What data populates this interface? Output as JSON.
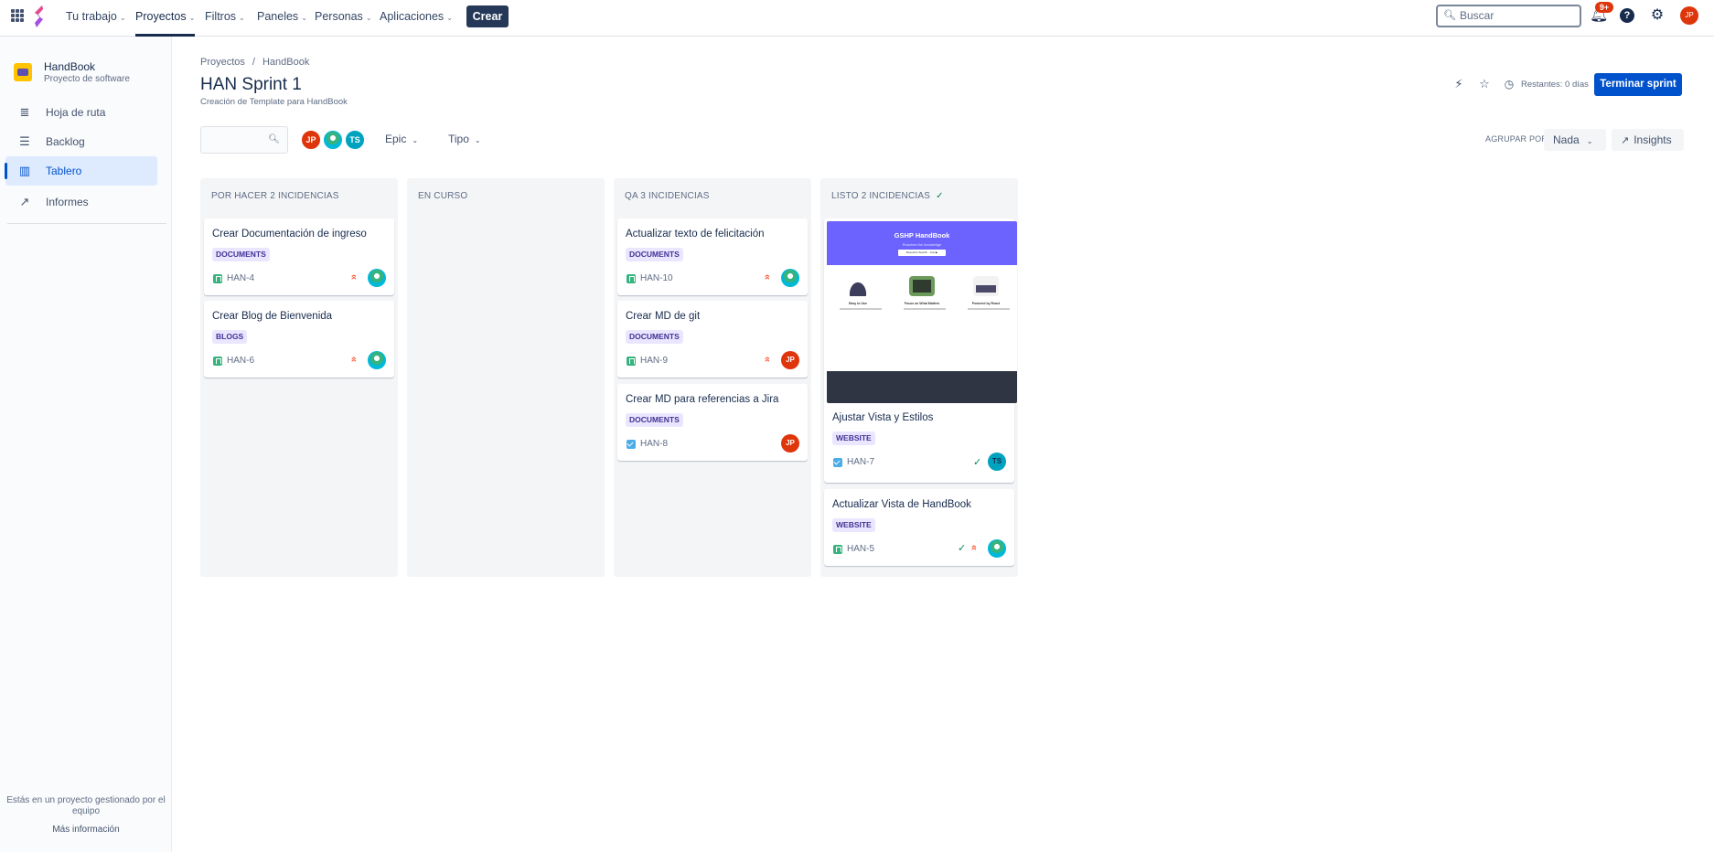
{
  "topnav": {
    "items": [
      {
        "label": "Tu trabajo"
      },
      {
        "label": "Proyectos"
      },
      {
        "label": "Filtros"
      },
      {
        "label": "Paneles"
      },
      {
        "label": "Personas"
      },
      {
        "label": "Aplicaciones"
      }
    ],
    "create_label": "Crear",
    "search_placeholder": "Buscar",
    "notifications_badge": "9+",
    "user_initials": "JP"
  },
  "sidebar": {
    "project_name": "HandBook",
    "project_type": "Proyecto de software",
    "items": [
      {
        "label": "Hoja de ruta",
        "icon": "roadmap-icon"
      },
      {
        "label": "Backlog",
        "icon": "backlog-icon"
      },
      {
        "label": "Tablero",
        "icon": "board-icon"
      },
      {
        "label": "Informes",
        "icon": "reports-icon"
      }
    ],
    "footer_text": "Estás en un proyecto gestionado por el equipo",
    "more_info": "Más información"
  },
  "header": {
    "breadcrumbs": [
      "Proyectos",
      "HandBook"
    ],
    "title": "HAN Sprint 1",
    "description": "Creación de Template para HandBook",
    "remaining": "Restantes: 0 días",
    "end_sprint_label": "Terminar sprint"
  },
  "filters": {
    "avatars": [
      "JP",
      "",
      "TS"
    ],
    "epic_label": "Epic",
    "type_label": "Tipo",
    "group_by_label": "AGRUPAR POR",
    "group_by_value": "Nada",
    "insights_label": "Insights"
  },
  "columns": [
    {
      "title": "POR HACER 2 INCIDENCIAS",
      "cards": [
        {
          "title": "Crear Documentación de ingreso",
          "label": "DOCUMENTS",
          "key": "HAN-4",
          "type": "story",
          "assignee": ""
        },
        {
          "title": "Crear Blog de Bienvenida",
          "label": "BLOGS",
          "key": "HAN-6",
          "type": "story",
          "assignee": ""
        }
      ]
    },
    {
      "title": "EN CURSO",
      "cards": []
    },
    {
      "title": "QA 3 INCIDENCIAS",
      "cards": [
        {
          "title": "Actualizar texto de felicitación",
          "label": "DOCUMENTS",
          "key": "HAN-10",
          "type": "story",
          "assignee": ""
        },
        {
          "title": "Crear MD de git",
          "label": "DOCUMENTS",
          "key": "HAN-9",
          "type": "story",
          "assignee": "JP"
        },
        {
          "title": "Crear MD para referencias a Jira",
          "label": "DOCUMENTS",
          "key": "HAN-8",
          "type": "task",
          "assignee": "JP"
        }
      ]
    },
    {
      "title": "LISTO 2 INCIDENCIAS",
      "cards": [
        {
          "title": "Ajustar Vista y Estilos",
          "label": "WEBSITE",
          "key": "HAN-7",
          "type": "task",
          "assignee": "TS",
          "cover": {
            "title": "GSHP HandBook",
            "subtitle": "Reaches the knowledge",
            "button": "Resource Search · Join ▶",
            "features": [
              "Easy to Use",
              "Focus on What Matters",
              "Powered by React"
            ]
          }
        },
        {
          "title": "Actualizar Vista de HandBook",
          "label": "WEBSITE",
          "key": "HAN-5",
          "type": "story",
          "assignee": ""
        }
      ]
    }
  ],
  "colors": {
    "primary": "#0052cc",
    "label_bg": "#eae6ff",
    "label_text": "#403294",
    "priority": "#ff5630",
    "done": "#00875a",
    "avatar_jp": "#de350b",
    "avatar_ts": "#00a3bf"
  }
}
